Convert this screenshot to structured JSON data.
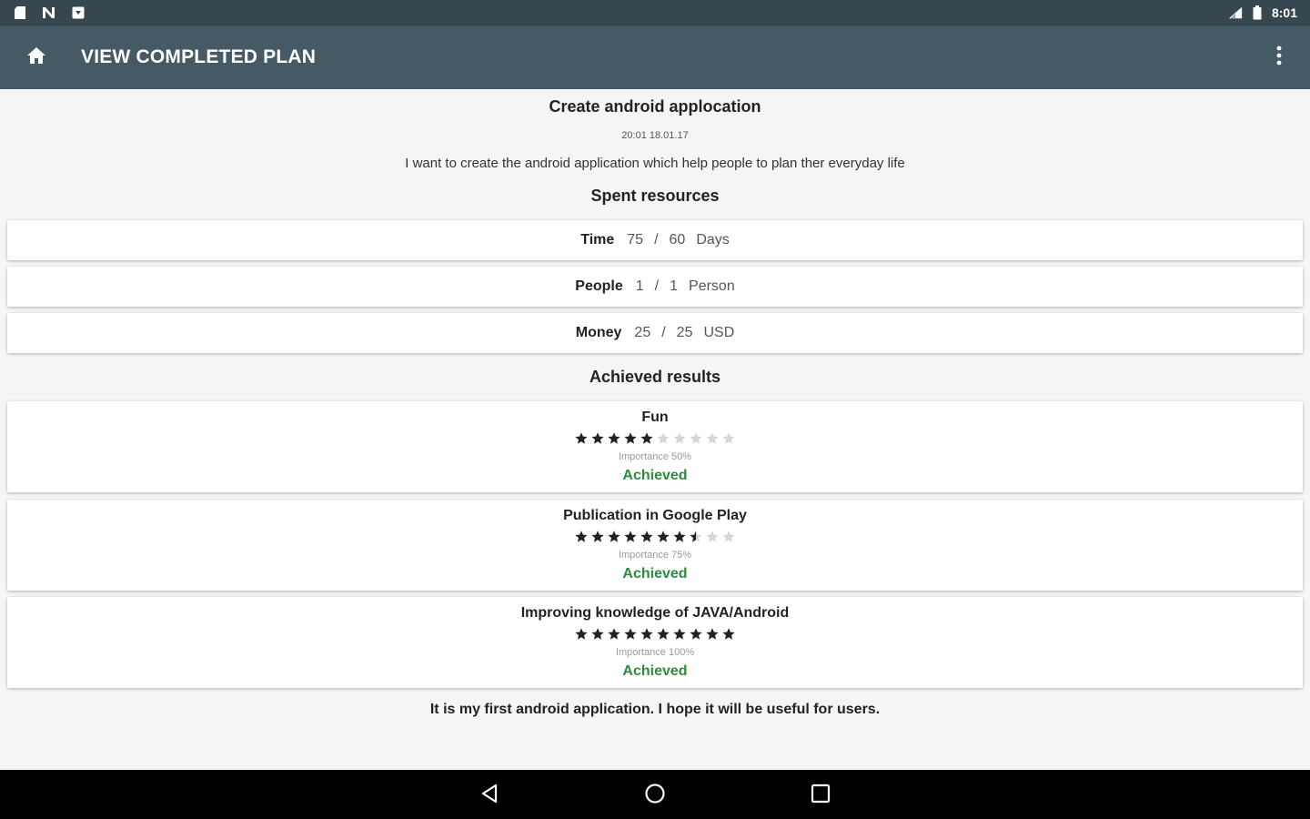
{
  "status_bar": {
    "time": "8:01",
    "left_icons": [
      "sd-card-icon",
      "n-notification-icon",
      "download-notification-icon"
    ],
    "right_icons": [
      "signal-icon",
      "battery-icon"
    ]
  },
  "toolbar": {
    "title": "VIEW COMPLETED PLAN",
    "home_icon": "home-icon",
    "overflow_icon": "more-vert-icon"
  },
  "plan": {
    "title": "Create android applocation",
    "date": "20:01 18.01.17",
    "description": "I want to create the android application which help people to plan ther everyday life"
  },
  "spent_resources": {
    "heading": "Spent resources",
    "items": [
      {
        "label": "Time",
        "spent": "75",
        "sep": "/",
        "planned": "60",
        "unit": "Days"
      },
      {
        "label": "People",
        "spent": "1",
        "sep": "/",
        "planned": "1",
        "unit": "Person"
      },
      {
        "label": "Money",
        "spent": "25",
        "sep": "/",
        "planned": "25",
        "unit": "USD"
      }
    ]
  },
  "achieved_results": {
    "heading": "Achieved results",
    "items": [
      {
        "name": "Fun",
        "rating": 5,
        "max": 10,
        "importance": "Importance 50%",
        "status": "Achieved"
      },
      {
        "name": "Publication in Google Play",
        "rating": 7.5,
        "max": 10,
        "importance": "Importance 75%",
        "status": "Achieved"
      },
      {
        "name": "Improving knowledge of JAVA/Android",
        "rating": 10,
        "max": 10,
        "importance": "Importance 100%",
        "status": "Achieved"
      }
    ]
  },
  "footer_note": "It is my first android application. I hope it will be useful for users.",
  "nav_bar": {
    "back_icon": "back-icon",
    "home_icon": "home-circle-icon",
    "recents_icon": "recents-icon"
  },
  "colors": {
    "status_bar": "#37474f",
    "toolbar": "#455a64",
    "achieved": "#2e8b3d",
    "star_filled": "#222222",
    "star_empty": "#d6d6d6"
  }
}
